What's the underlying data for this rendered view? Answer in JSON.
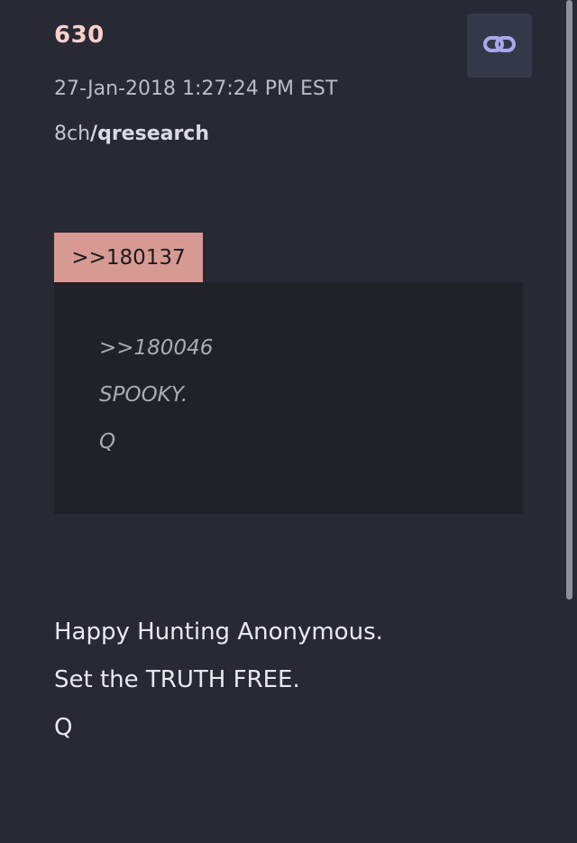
{
  "post": {
    "number": "630",
    "timestamp": "27-Jan-2018 1:27:24 PM EST",
    "source_prefix": "8ch",
    "board": "/qresearch",
    "reply_ref": ">>180137"
  },
  "quote": {
    "lines": [
      ">>180046",
      "SPOOKY.",
      "Q"
    ]
  },
  "message": {
    "lines": [
      "Happy Hunting Anonymous.",
      "Set the TRUTH FREE.",
      "Q"
    ]
  },
  "icons": {
    "link": "link-icon"
  },
  "colors": {
    "background": "#272a35",
    "post_number": "#f8d0cc",
    "reply_ref_bg": "#d79a93",
    "quote_bg": "#212229",
    "link_button_bg": "#353849",
    "link_icon": "#a9a6ec"
  }
}
